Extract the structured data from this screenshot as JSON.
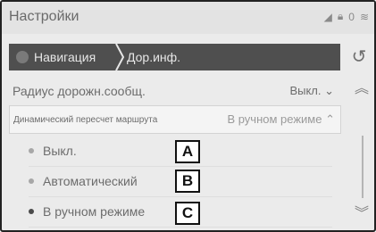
{
  "app": {
    "title": "Настройки"
  },
  "status": {
    "icons": [
      "signal-icon",
      "lock-icon",
      "battery-icon",
      "wifi-icon"
    ],
    "badge": "0"
  },
  "breadcrumb": {
    "level1": "Навигация",
    "level2": "Дор.инф."
  },
  "settings": {
    "row1": {
      "label": "Радиус дорожн.сообщ.",
      "value": "Выкл."
    },
    "row2": {
      "label": "Динамический пересчет маршрута",
      "value": "В ручном режиме"
    }
  },
  "options": [
    {
      "label": "Выкл.",
      "tag": "A",
      "selected": false
    },
    {
      "label": "Автоматический",
      "tag": "B",
      "selected": false
    },
    {
      "label": "В ручном режиме",
      "tag": "C",
      "selected": true
    }
  ]
}
